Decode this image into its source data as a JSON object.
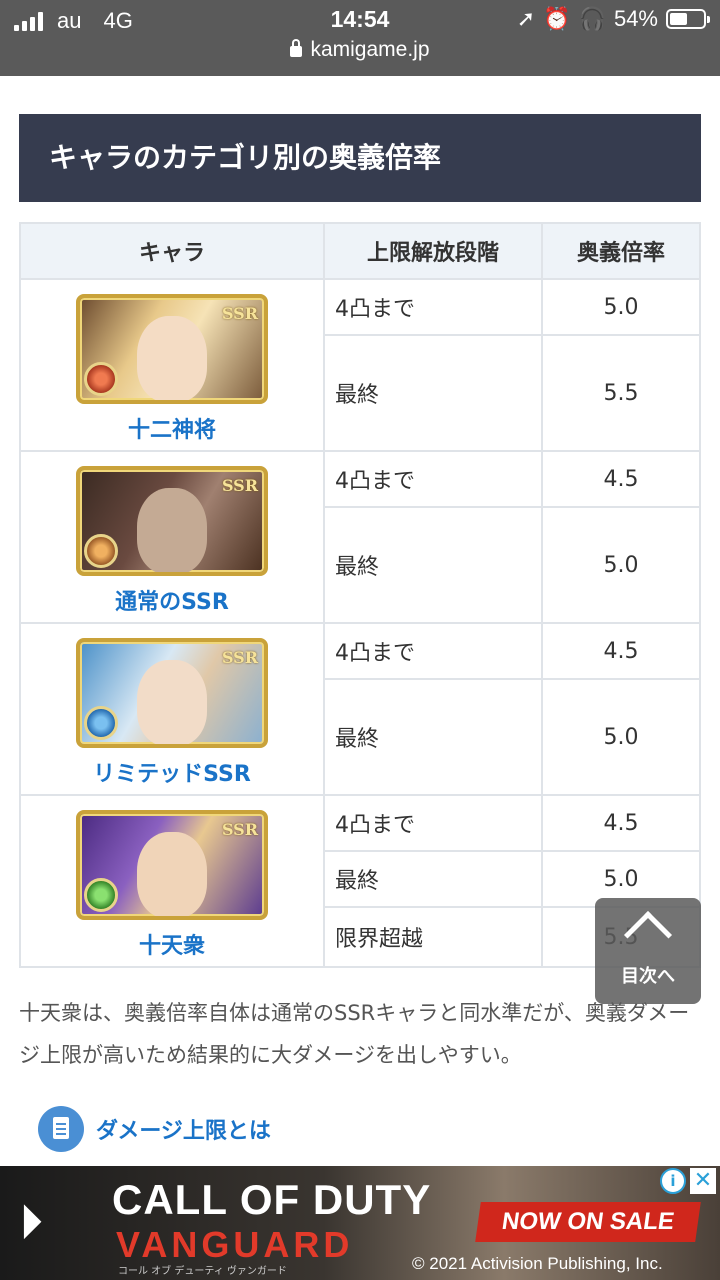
{
  "status_bar": {
    "carrier": "au",
    "network": "4G",
    "time": "14:54",
    "battery": "54%",
    "battery_level": 0.54,
    "url": "kamigame.jp"
  },
  "section_title": "キャラのカテゴリ別の奥義倍率",
  "table": {
    "headers": [
      "キャラ",
      "上限解放段階",
      "奥義倍率"
    ],
    "groups": [
      {
        "name": "十二神将",
        "rows": [
          {
            "stage": "4凸まで",
            "rate": "5.0"
          },
          {
            "stage": "最終",
            "rate": "5.5"
          }
        ]
      },
      {
        "name": "通常のSSR",
        "rows": [
          {
            "stage": "4凸まで",
            "rate": "4.5"
          },
          {
            "stage": "最終",
            "rate": "5.0"
          }
        ]
      },
      {
        "name": "リミテッドSSR",
        "rows": [
          {
            "stage": "4凸まで",
            "rate": "4.5"
          },
          {
            "stage": "最終",
            "rate": "5.0"
          }
        ]
      },
      {
        "name": "十天衆",
        "rows": [
          {
            "stage": "4凸まで",
            "rate": "4.5"
          },
          {
            "stage": "最終",
            "rate": "5.0"
          },
          {
            "stage": "限界超越",
            "rate": "5.5"
          }
        ]
      }
    ],
    "badge": "SSR"
  },
  "note": "十天衆は、奥義倍率自体は通常のSSRキャラと同水準だが、奥義ダメージ上限が高いため結果的に大ダメージを出しやすい。",
  "link": "ダメージ上限とは",
  "toc_button": "目次へ",
  "ad": {
    "title_line1": "CALL OF DUTY",
    "title_line2": "VANGUARD",
    "subtitle": "コール オブ デューティ ヴァンガード",
    "sale": "NOW ON SALE",
    "copyright": "© 2021 Activision Publishing, Inc.",
    "info": "i",
    "close": "✕"
  }
}
